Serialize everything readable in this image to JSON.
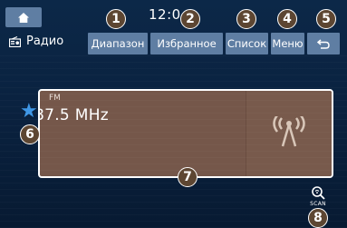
{
  "status_bar": {
    "time": "12:0"
  },
  "title": {
    "label": "Радио"
  },
  "toolbar": {
    "band_label": "Диапазон",
    "favorites_label": "Избранное",
    "list_label": "Список",
    "menu_label": "Меню"
  },
  "station": {
    "band": "FM",
    "frequency": "87.5 MHz"
  },
  "scan": {
    "label": "SCAN"
  },
  "callouts": [
    "1",
    "2",
    "3",
    "4",
    "5",
    "6",
    "7",
    "8"
  ],
  "icons": {
    "home": "home-icon",
    "radio": "radio-icon",
    "back": "back-icon",
    "favorite": "star-icon",
    "broadcast": "antenna-icon",
    "scan": "scan-icon"
  },
  "colors": {
    "background": "#0c2848",
    "button": "#5f7ea3",
    "card": "#75574a",
    "star": "#3f97e6",
    "callout": "#5d4632"
  }
}
